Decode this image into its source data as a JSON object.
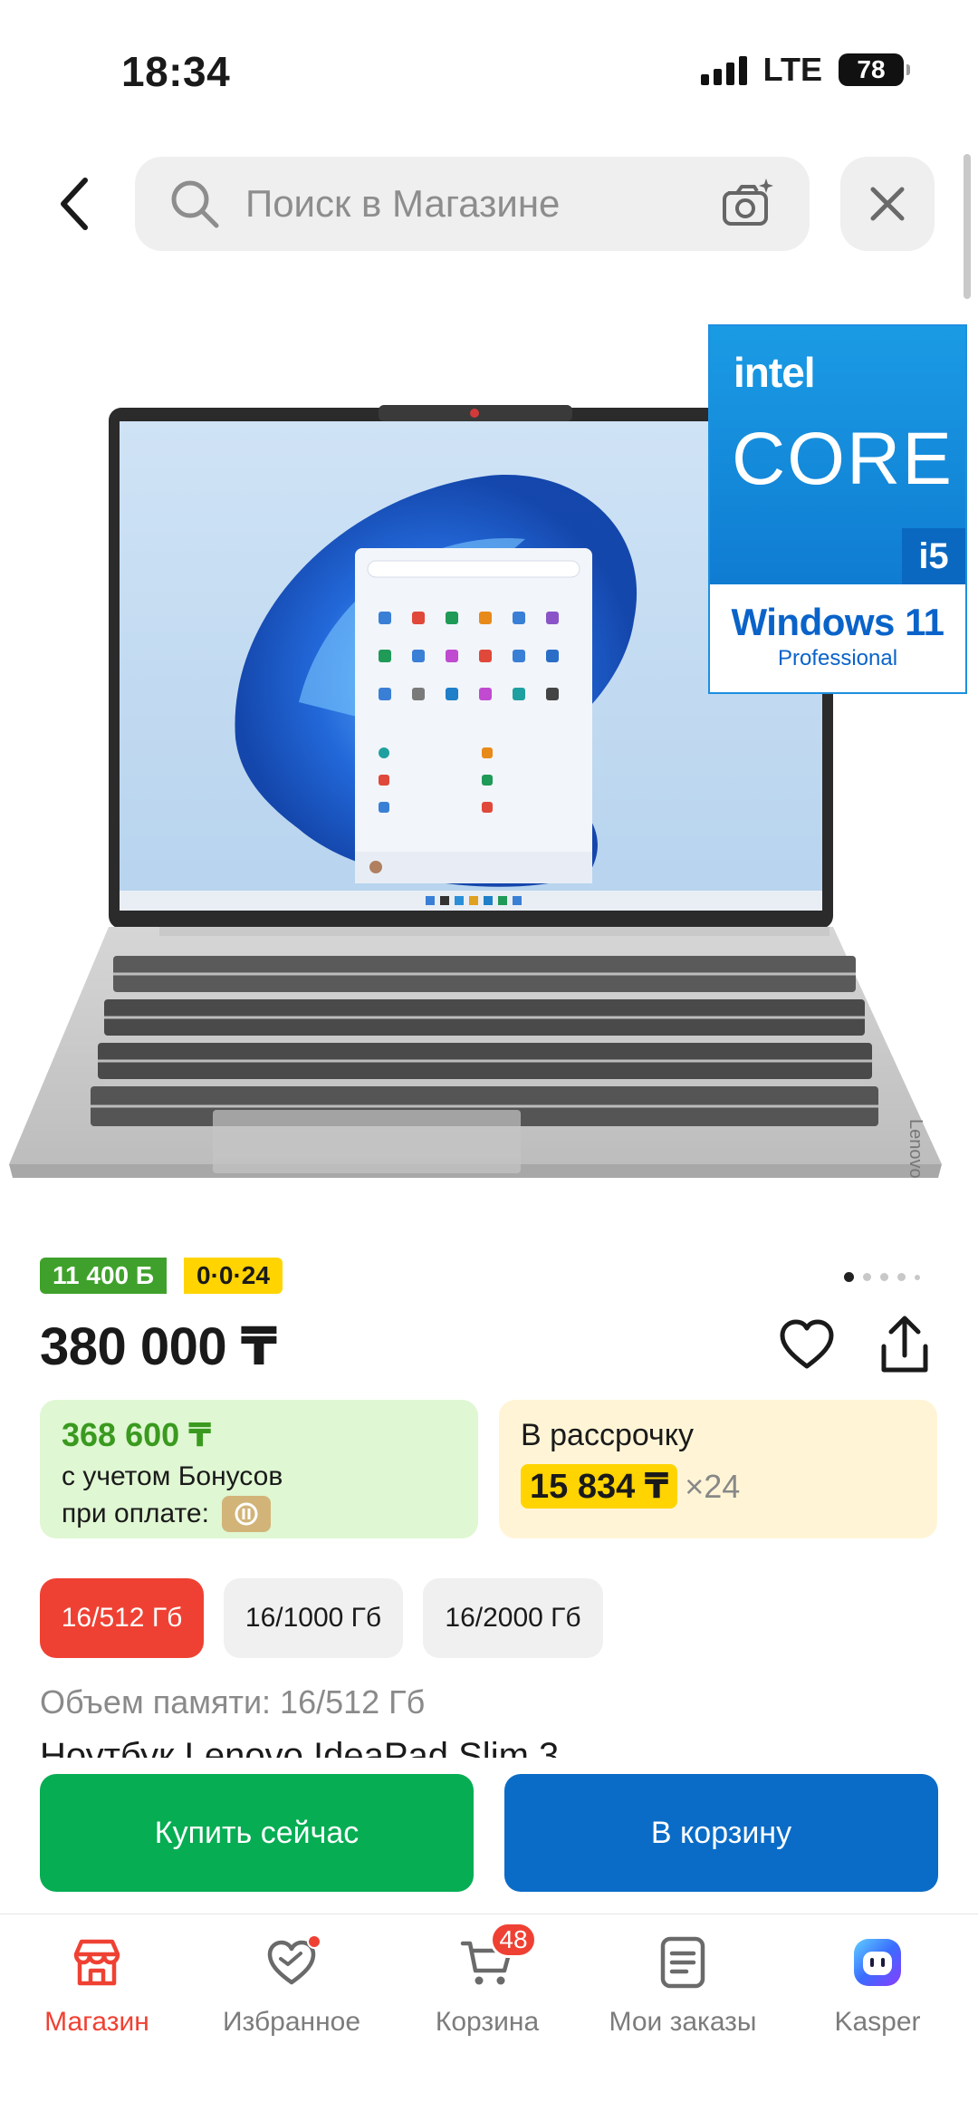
{
  "status_bar": {
    "time": "18:34",
    "network": "LTE",
    "battery": "78"
  },
  "search": {
    "placeholder": "Поиск в Магазине"
  },
  "product": {
    "badge_intel": {
      "brand": "intel",
      "line": "CORE",
      "tier": "i5",
      "os": "Windows 11",
      "os_edition": "Professional"
    },
    "laptop_brand": "Lenovo",
    "bonus_badge": "11 400 Б",
    "installment_badge": "0·0·24",
    "gallery": {
      "total": 5,
      "active_index": 0
    },
    "price": "380 000 ₸",
    "bonus_card": {
      "amount": "368 600 ₸",
      "line1": "с учетом Бонусов",
      "line2": "при оплате:"
    },
    "installment_card": {
      "title": "В рассрочку",
      "amount": "15 834 ₸",
      "multiplier": "×24"
    },
    "variants": [
      {
        "label": "16/512 Гб",
        "selected": true
      },
      {
        "label": "16/1000 Гб",
        "selected": false
      },
      {
        "label": "16/2000 Гб",
        "selected": false
      }
    ],
    "memory_line": "Объем памяти: 16/512 Гб",
    "title_partial": "Ноутбук Lenovo IdeaPad Slim 3"
  },
  "actions": {
    "buy_now": "Купить сейчас",
    "add_to_cart": "В корзину"
  },
  "colors": {
    "accent_red": "#ef4133",
    "buy_green": "#06ad53",
    "cart_blue": "#0a6cc7",
    "bonus_green": "#3fa12b",
    "installment_yellow": "#ffd400"
  },
  "tab_bar": {
    "tabs": [
      {
        "label": "Магазин",
        "icon": "store-icon",
        "active": true
      },
      {
        "label": "Избранное",
        "icon": "heart-icon",
        "active": false
      },
      {
        "label": "Корзина",
        "icon": "cart-icon",
        "active": false,
        "badge": "48"
      },
      {
        "label": "Мои заказы",
        "icon": "orders-icon",
        "active": false
      },
      {
        "label": "Kasper",
        "icon": "kasper-assistant-icon",
        "active": false
      }
    ]
  }
}
